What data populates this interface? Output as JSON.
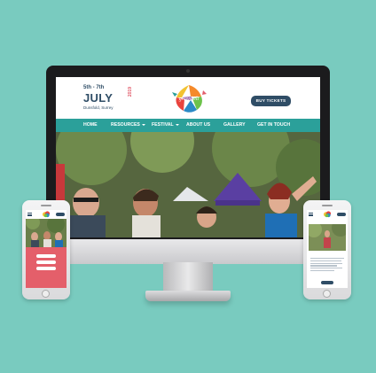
{
  "site": {
    "date_range": "5th - 7th",
    "month": "JULY",
    "year": "2019",
    "location": "Dunsfold, Surrey",
    "buy_tickets": "BUY TICKETS",
    "nav": [
      {
        "label": "HOME",
        "has_dropdown": false
      },
      {
        "label": "RESOURCES",
        "has_dropdown": true
      },
      {
        "label": "FESTIVAL",
        "has_dropdown": true
      },
      {
        "label": "ABOUT US",
        "has_dropdown": false
      },
      {
        "label": "GALLERY",
        "has_dropdown": false
      },
      {
        "label": "GET IN TOUCH",
        "has_dropdown": false
      }
    ]
  },
  "colors": {
    "background": "#79cbbf",
    "navy": "#2f4d66",
    "teal_nav": "#2ba09a",
    "coral": "#e45f6a"
  },
  "icons": [
    "festival-logo-icon",
    "dropdown-caret-icon",
    "hamburger-menu-icon"
  ]
}
